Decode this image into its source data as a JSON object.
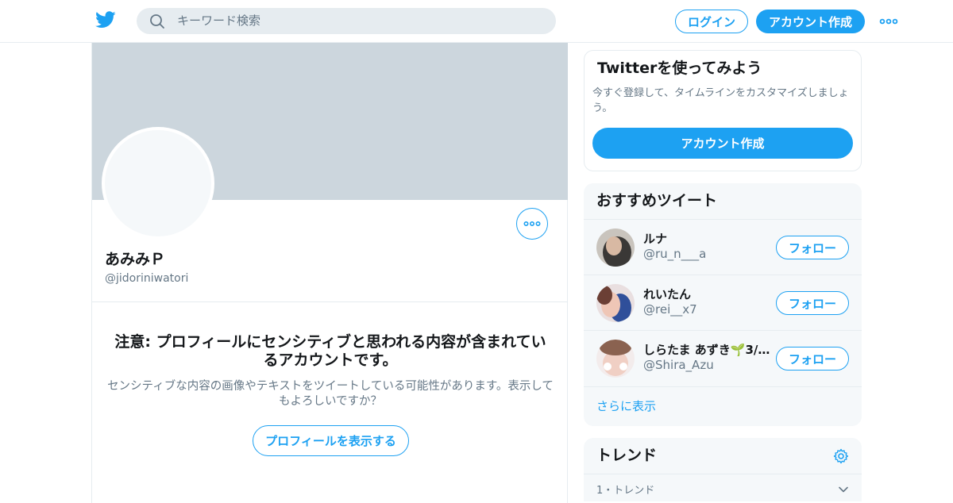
{
  "header": {
    "search_placeholder": "キーワード検索",
    "login_label": "ログイン",
    "signup_label": "アカウント作成",
    "icons": [
      "twitter-logo-icon",
      "search-icon",
      "more-dots-icon"
    ]
  },
  "profile": {
    "display_name": "あみみＰ",
    "screen_name": "@jidoriniwatori",
    "warning_title": "注意: プロフィールにセンシティブと思われる内容が含まれているアカウントです。",
    "warning_body": "センシティブな内容の画像やテキストをツイートしている可能性があります。表示してもよろしいですか？",
    "view_button": "プロフィールを表示する"
  },
  "signup_card": {
    "title": "Twitterを使ってみよう",
    "description": "今すぐ登録して、タイムラインをカスタマイズしましょう。",
    "button": "アカウント作成"
  },
  "recommendations": {
    "title": "おすすめツイート",
    "items": [
      {
        "name": "ルナ",
        "handle": "@ru_n___a",
        "follow": "フォロー"
      },
      {
        "name": "れいたん",
        "handle": "@rei__x7",
        "follow": "フォロー"
      },
      {
        "name": "しらたま あずき🌱3/...",
        "handle": "@Shira_Azu",
        "follow": "フォロー"
      }
    ],
    "show_more": "さらに表示"
  },
  "trends": {
    "title": "トレンド",
    "first_item_label": "1・トレンド"
  },
  "colors": {
    "accent": "#1da1f2",
    "banner": "#ccd6dd",
    "muted_text": "#657786",
    "panel_bg": "#f5f8fa"
  }
}
